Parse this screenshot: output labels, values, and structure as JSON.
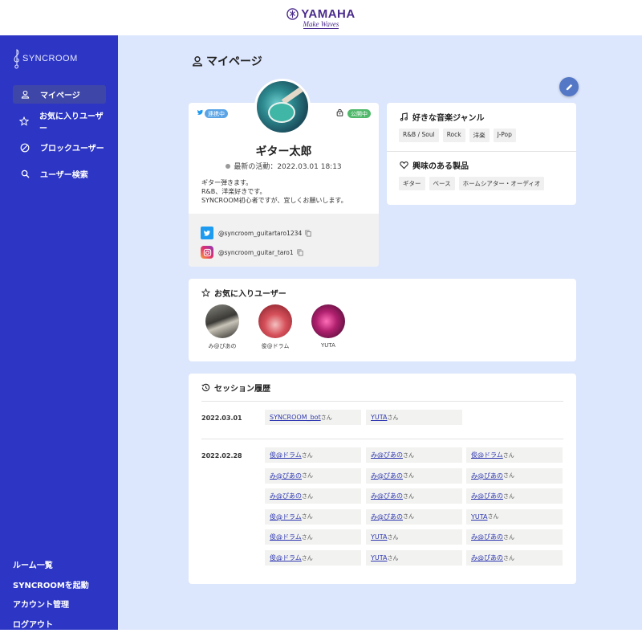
{
  "header": {
    "brand": "YAMAHA",
    "tagline": "Make Waves"
  },
  "sidebar": {
    "logo": "SYNCROOM",
    "items": [
      {
        "label": "マイページ",
        "icon": "person-icon",
        "active": true
      },
      {
        "label": "お気に入りユーザー",
        "icon": "star-icon",
        "active": false
      },
      {
        "label": "ブロックユーザー",
        "icon": "block-icon",
        "active": false
      },
      {
        "label": "ユーザー検索",
        "icon": "search-icon",
        "active": false
      }
    ],
    "bottom": [
      "ルーム一覧",
      "SYNCROOMを起動",
      "アカウント管理",
      "ログアウト"
    ]
  },
  "page": {
    "title": "マイページ"
  },
  "profile": {
    "linked_badge": "連携中",
    "public_badge": "公開中",
    "name": "ギター太郎",
    "activity": "最新の活動：2022.03.01 18:13",
    "bio": [
      "ギター弾きます。",
      "R&B、洋楽好きです。",
      "SYNCROOM初心者ですが、宜しくお願いします。"
    ],
    "twitter": "@syncroom_guitartaro1234",
    "instagram": "@syncroom_guitar_taro1"
  },
  "genres": {
    "title": "好きな音楽ジャンル",
    "items": [
      "R&B / Soul",
      "Rock",
      "洋楽",
      "J-Pop"
    ]
  },
  "products": {
    "title": "興味のある製品",
    "items": [
      "ギター",
      "ベース",
      "ホームシアター・オーディオ"
    ]
  },
  "favorites": {
    "title": "お気に入りユーザー",
    "users": [
      {
        "name": "み@ぴあの"
      },
      {
        "name": "俊@ドラム"
      },
      {
        "name": "YUTA"
      }
    ]
  },
  "history": {
    "title": "セッション履歴",
    "suffix": "さん",
    "sessions": [
      {
        "date": "2022.03.01",
        "users": [
          "SYNCROOM_bot",
          "YUTA"
        ]
      },
      {
        "date": "2022.02.28",
        "users": [
          "俊@ドラム",
          "み@ぴあの",
          "俊@ドラム",
          "み@ぴあの",
          "み@ぴあの",
          "み@ぴあの",
          "み@ぴあの",
          "み@ぴあの",
          "み@ぴあの",
          "俊@ドラム",
          "み@ぴあの",
          "YUTA",
          "俊@ドラム",
          "YUTA",
          "み@ぴあの",
          "俊@ドラム",
          "YUTA",
          "み@ぴあの"
        ]
      }
    ]
  },
  "colors": {
    "sidebar": "#2d36c4",
    "main_bg": "#dce6fc",
    "accent": "#5478c6",
    "link": "#2e37b0"
  }
}
